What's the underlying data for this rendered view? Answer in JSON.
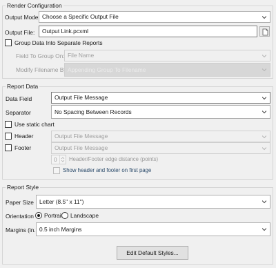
{
  "render_config": {
    "title": "Render Configuration",
    "output_mode_label": "Output Mode:",
    "output_mode_value": "Choose a Specific Output File",
    "output_file_label": "Output File:",
    "output_file_value": "Output Link.pcxml",
    "group_data_label": "Group Data Into Separate Reports",
    "field_to_group_label": "Field To Group On:",
    "field_to_group_value": "File Name",
    "modify_filename_label": "Modify Filename By:",
    "modify_filename_value": "Appending Group To Filename"
  },
  "report_data": {
    "title": "Report Data",
    "data_field_label": "Data Field",
    "data_field_value": "Output File Message",
    "separator_label": "Separator",
    "separator_value": "No Spacing Between Records",
    "use_static_chart_label": "Use static chart",
    "header_label": "Header",
    "header_value": "Output File Message",
    "footer_label": "Footer",
    "footer_value": "Output File Message",
    "edge_distance_value": "0",
    "edge_distance_label": "Header/Footer edge distance (points)",
    "show_header_footer_label": "Show header and footer on first page"
  },
  "report_style": {
    "title": "Report Style",
    "paper_size_label": "Paper Size",
    "paper_size_value": "Letter (8.5\" x 11\")",
    "orientation_label": "Orientation",
    "portrait_label": "Portrait",
    "landscape_label": "Landscape",
    "margins_label": "Margins (in.)",
    "margins_value": "0.5 inch Margins",
    "edit_styles_button": "Edit Default Styles..."
  }
}
